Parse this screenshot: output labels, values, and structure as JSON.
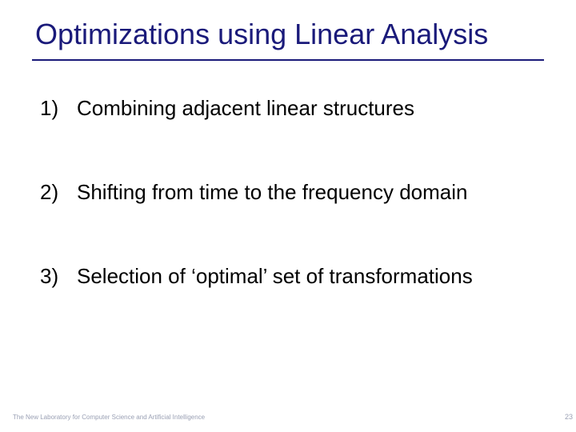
{
  "title": "Optimizations using Linear Analysis",
  "items": [
    {
      "num": "1)",
      "text": "Combining adjacent linear structures"
    },
    {
      "num": "2)",
      "text": "Shifting from time to the frequency domain"
    },
    {
      "num": "3)",
      "text": "Selection of ‘optimal’ set of transformations"
    }
  ],
  "footer_left": "The New Laboratory for Computer Science and Artificial Intelligence",
  "footer_right": "23"
}
